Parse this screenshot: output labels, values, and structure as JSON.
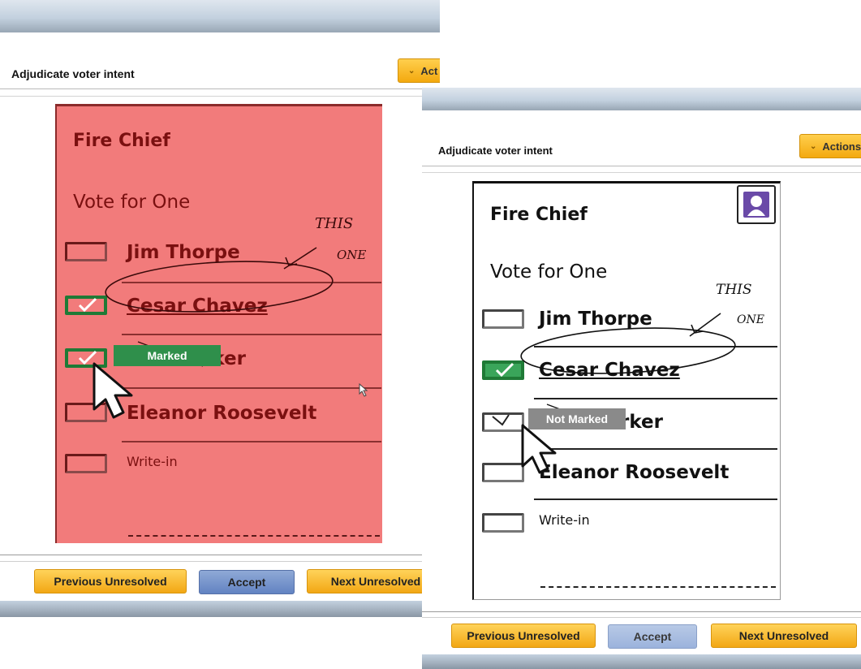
{
  "header": {
    "title": "Adjudicate voter intent"
  },
  "panels": [
    {
      "actions_label": "Act"
    },
    {
      "actions_label": "Actions"
    }
  ],
  "ballot": {
    "contest": "Fire Chief",
    "instruction": "Vote for One",
    "candidates": [
      "Jim Thorpe",
      "Cesar Chavez",
      "rker",
      "Eleanor Roosevelt"
    ],
    "candidates_panel_b": [
      "Jim Thorpe",
      "Cesar Chavez",
      "rker",
      "Eleanor Roosevelt"
    ],
    "write_in": "Write-in",
    "handwriting": [
      "THIS",
      "ONE"
    ]
  },
  "popups": {
    "marked": "Marked",
    "not_marked": "Not Marked"
  },
  "footer": {
    "previous": "Previous Unresolved",
    "accept": "Accept",
    "next": "Next Unresolved"
  },
  "colors": {
    "marked_overlay": "#f27b7b",
    "marked_popup": "#2f8f4b",
    "not_marked_popup": "#8a8a8a",
    "accent_gold": "#f3a90f",
    "accept_blue": "#6283c2"
  }
}
